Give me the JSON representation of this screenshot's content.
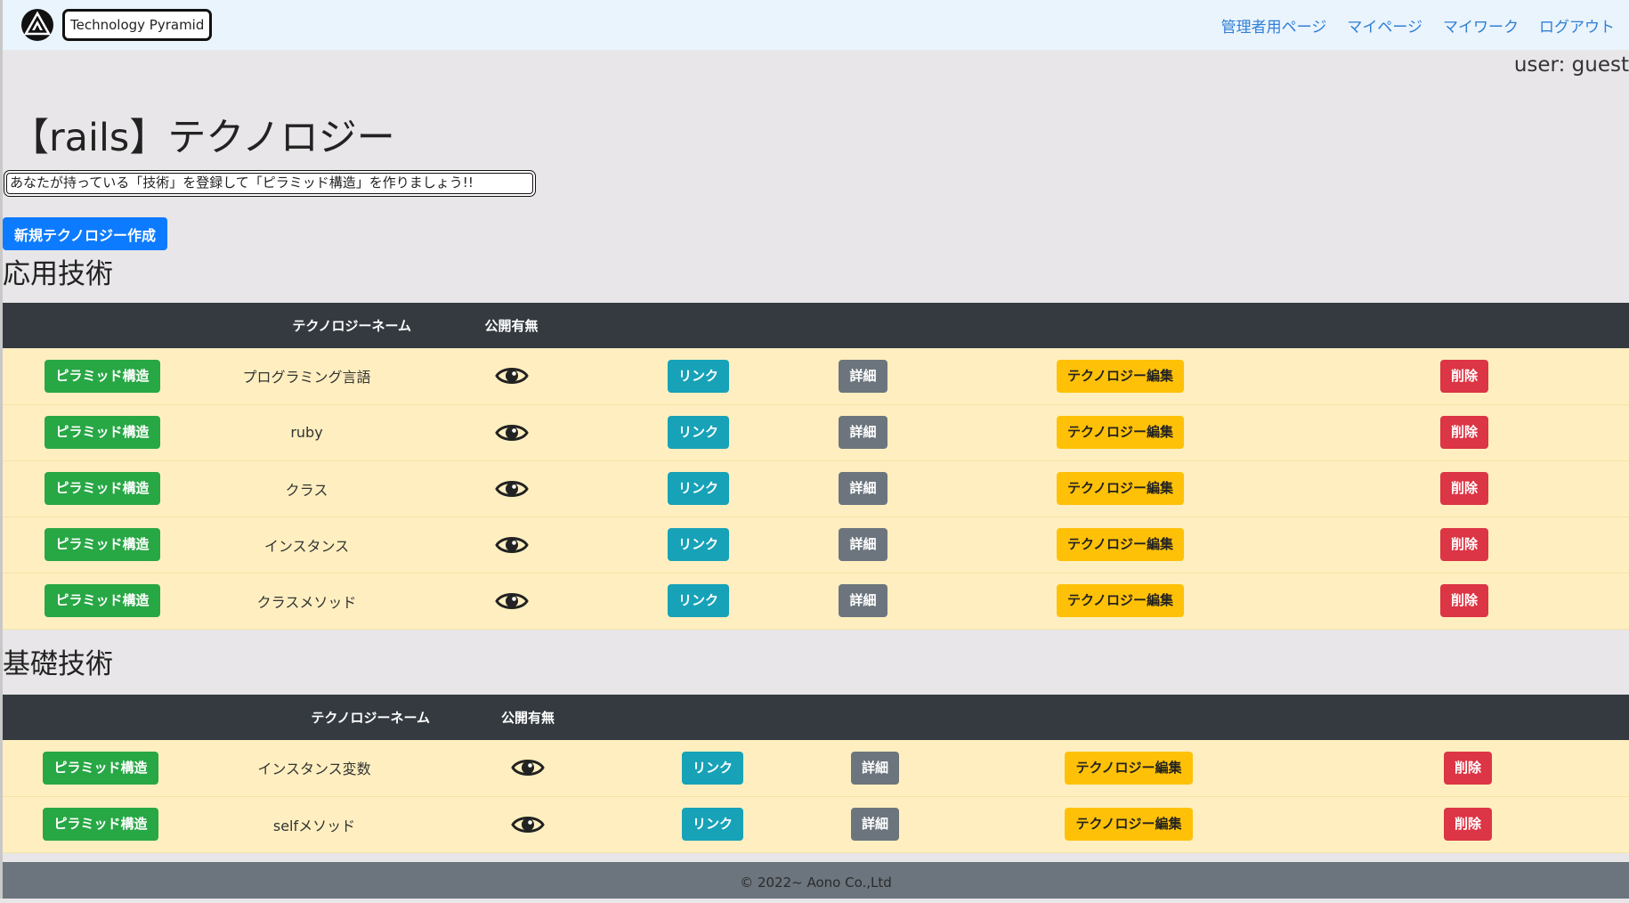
{
  "navbar": {
    "brand": "Technology Pyramid",
    "links": [
      "管理者用ページ",
      "マイページ",
      "マイワーク",
      "ログアウト"
    ]
  },
  "user_label": "user: guest",
  "page_title": "【rails】テクノロジー",
  "tagline": "あなたが持っている「技術」を登録して「ピラミッド構造」を作りましょう!!",
  "new_button": "新規テクノロジー作成",
  "columns": {
    "name": "テクノロジーネーム",
    "public": "公開有無"
  },
  "buttons": {
    "pyramid": "ピラミッド構造",
    "link": "リンク",
    "detail": "詳細",
    "edit": "テクノロジー編集",
    "delete": "削除"
  },
  "sections": [
    {
      "title": "応用技術",
      "rows": [
        "プログラミング言語",
        "ruby",
        "クラス",
        "インスタンス",
        "クラスメソッド"
      ]
    },
    {
      "title": "基礎技術",
      "rows": [
        "インスタンス変数",
        "selfメソッド"
      ]
    }
  ],
  "footer": "© 2022~ Aono Co.,Ltd",
  "colors": {
    "navbar_bg": "#eaf4fd",
    "row_bg": "#ffefc0",
    "header_bg": "#343a40",
    "primary": "#0d7bff",
    "success": "#28a745",
    "info": "#17a2b8",
    "secondary": "#6c757d",
    "warning": "#ffc107",
    "danger": "#dc3545"
  },
  "icons": {
    "logo": "pyramid-logo-icon",
    "public": "eye-icon"
  }
}
